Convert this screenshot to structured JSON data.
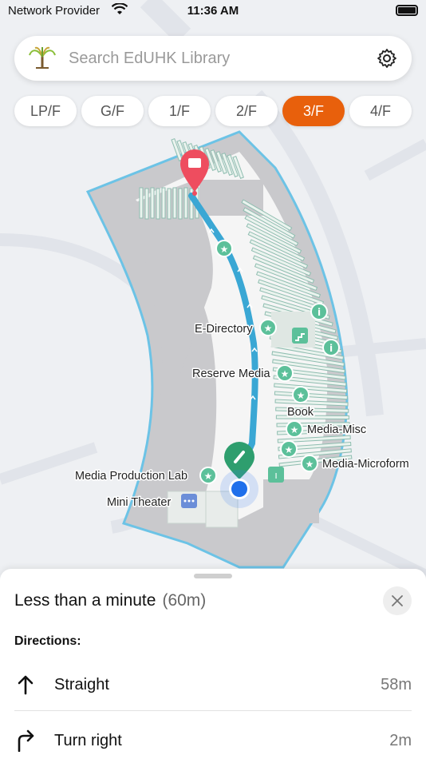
{
  "status_bar": {
    "carrier": "Network Provider",
    "time": "11:36 AM"
  },
  "search": {
    "placeholder": "Search EdUHK Library",
    "logo_icon": "tree-logo-icon",
    "settings_icon": "gear-icon"
  },
  "floors": {
    "items": [
      "LP/F",
      "G/F",
      "1/F",
      "2/F",
      "3/F",
      "4/F"
    ],
    "selected": "3/F",
    "accent_color": "#e8600c"
  },
  "map": {
    "route_color": "#3aa7d4",
    "destination_pin_color": "#ee4d5f",
    "origin_pin_color": "#2e9e6e",
    "poi_color": "#5cc09a",
    "labels": {
      "e_directory": "E-Directory",
      "reserve_media": "Reserve Media",
      "book": "Book",
      "media_misc": "Media-Misc",
      "media_microform": "Media-Microform",
      "media_production_lab": "Media Production Lab",
      "mini_theater": "Mini Theater"
    }
  },
  "sheet": {
    "title": "Less than a minute",
    "distance": "(60m)",
    "directions_label": "Directions:",
    "steps": [
      {
        "label": "Straight",
        "distance": "58m",
        "icon": "arrow-up-icon"
      },
      {
        "label": "Turn right",
        "distance": "2m",
        "icon": "turn-right-icon"
      }
    ]
  }
}
